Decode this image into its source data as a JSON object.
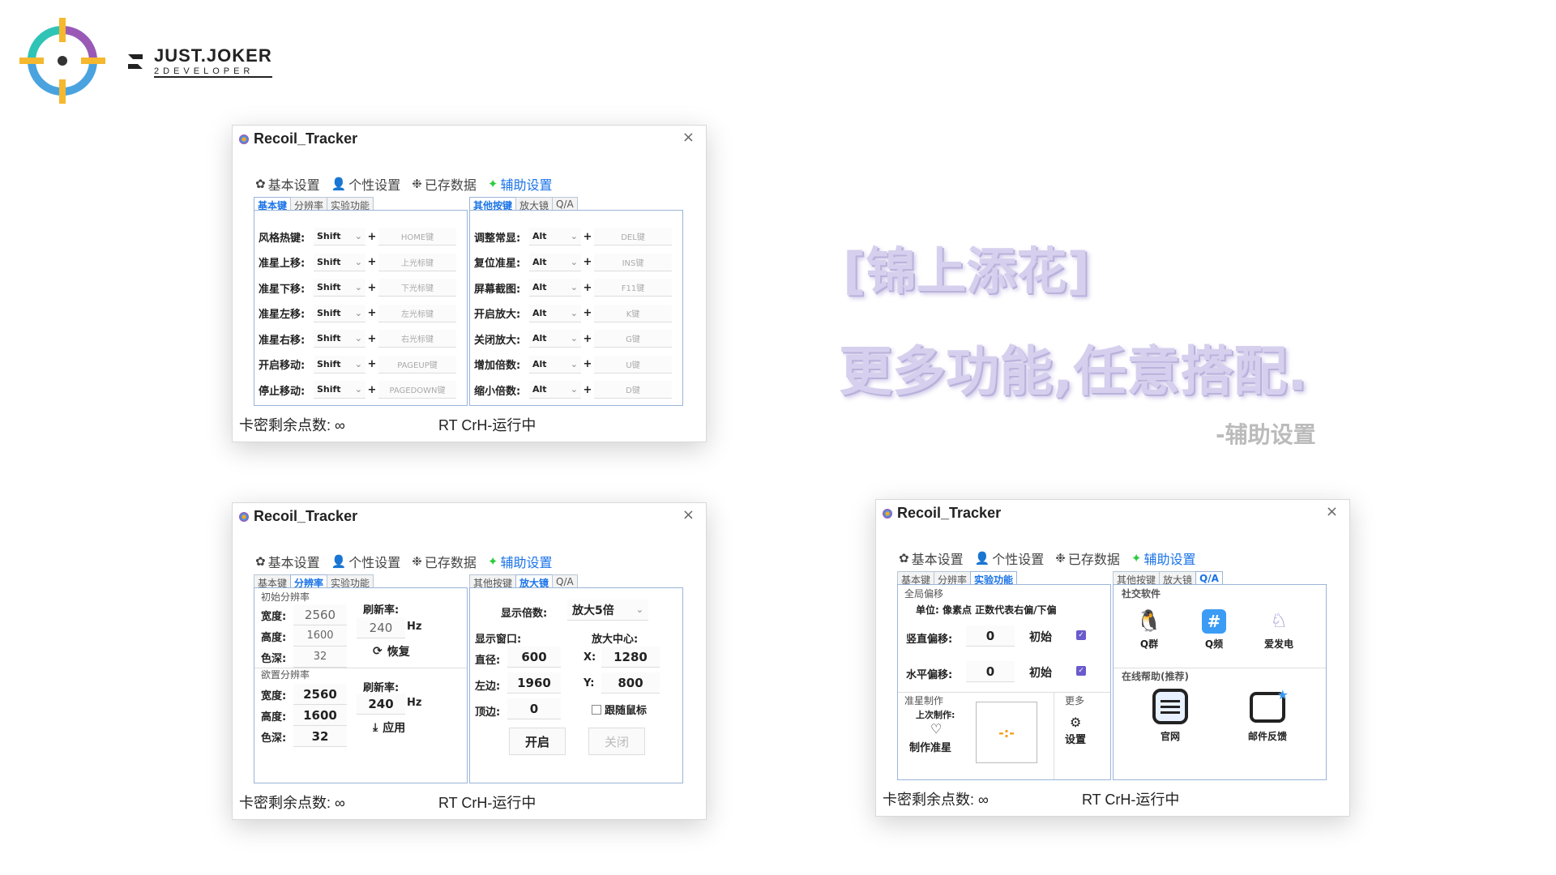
{
  "logo": {
    "line1": "JUST.JOKER",
    "line2": "2DEVELOPER"
  },
  "tagline": {
    "title": "[锦上添花]",
    "subtitle": "更多功能,任意搭配.",
    "note": "-辅助设置"
  },
  "app": {
    "title": "Recoil_Tracker",
    "close": "×"
  },
  "nav": [
    {
      "icon": "gear-icon",
      "label": "基本设置"
    },
    {
      "icon": "user-icon",
      "label": "个性设置"
    },
    {
      "icon": "snowflake-icon",
      "label": "已存数据"
    },
    {
      "icon": "leaf-icon",
      "label": "辅助设置"
    }
  ],
  "footer": {
    "points_label": "卡密剩余点数:",
    "points_value": "∞",
    "status": "RT CrH-运行中"
  },
  "left_tabs": [
    "基本键",
    "分辨率",
    "实验功能"
  ],
  "right_tabs": [
    "其他按键",
    "放大镜",
    "Q/A"
  ],
  "win1": {
    "left_rows": [
      {
        "label": "风格热键:",
        "mod": "Shift",
        "key": "HOME键"
      },
      {
        "label": "准星上移:",
        "mod": "Shift",
        "key": "上光标键"
      },
      {
        "label": "准星下移:",
        "mod": "Shift",
        "key": "下光标键"
      },
      {
        "label": "准星左移:",
        "mod": "Shift",
        "key": "左光标键"
      },
      {
        "label": "准星右移:",
        "mod": "Shift",
        "key": "右光标键"
      },
      {
        "label": "开启移动:",
        "mod": "Shift",
        "key": "PAGEUP键"
      },
      {
        "label": "停止移动:",
        "mod": "Shift",
        "key": "PAGEDOWN键"
      }
    ],
    "right_rows": [
      {
        "label": "调整常显:",
        "mod": "Alt",
        "key": "DEL键"
      },
      {
        "label": "复位准星:",
        "mod": "Alt",
        "key": "INS键"
      },
      {
        "label": "屏幕截图:",
        "mod": "Alt",
        "key": "F11键"
      },
      {
        "label": "开启放大:",
        "mod": "Alt",
        "key": "K键"
      },
      {
        "label": "关闭放大:",
        "mod": "Alt",
        "key": "G键"
      },
      {
        "label": "增加倍数:",
        "mod": "Alt",
        "key": "U键"
      },
      {
        "label": "缩小倍数:",
        "mod": "Alt",
        "key": "D键"
      }
    ]
  },
  "win2": {
    "initial": {
      "section": "初始分辨率",
      "width_label": "宽度:",
      "width": "2560",
      "height_label": "高度:",
      "height": "1600",
      "depth_label": "色深:",
      "depth": "32",
      "refresh_label": "刷新率:",
      "refresh": "240",
      "hz": "Hz",
      "restore": "恢复"
    },
    "desired": {
      "section": "欲置分辨率",
      "width_label": "宽度:",
      "width": "2560",
      "height_label": "高度:",
      "height": "1600",
      "depth_label": "色深:",
      "depth": "32",
      "refresh_label": "刷新率:",
      "refresh": "240",
      "hz": "Hz",
      "apply": "应用"
    },
    "zoom": {
      "mult_label": "显示倍数:",
      "mult": "放大5倍",
      "window_label": "显示窗口:",
      "center_label": "放大中心:",
      "diam_label": "直径:",
      "diam": "600",
      "x_label": "X:",
      "x": "1280",
      "left_label": "左边:",
      "left": "1960",
      "y_label": "Y:",
      "y": "800",
      "top_label": "顶边:",
      "top": "0",
      "follow": "跟随鼠标",
      "open": "开启",
      "close": "关闭"
    }
  },
  "win3": {
    "offset": {
      "section": "全局偏移",
      "unit": "单位: 像素点 正数代表右偏/下偏",
      "v_label": "竖直偏移:",
      "v": "0",
      "h_label": "水平偏移:",
      "h": "0",
      "init": "初始"
    },
    "crosshair": {
      "section": "准星制作",
      "last": "上次制作:",
      "make": "制作准星",
      "more": "更多",
      "settings": "设置"
    },
    "social": {
      "section": "社交软件",
      "items": [
        "Q群",
        "Q频",
        "爱发电"
      ]
    },
    "help": {
      "section": "在线帮助(推荐)",
      "items": [
        "官网",
        "邮件反馈"
      ]
    }
  },
  "colors": {
    "accent": "#1a73e8",
    "border": "#9ab5d8",
    "tagline": "#d6d0ee"
  }
}
